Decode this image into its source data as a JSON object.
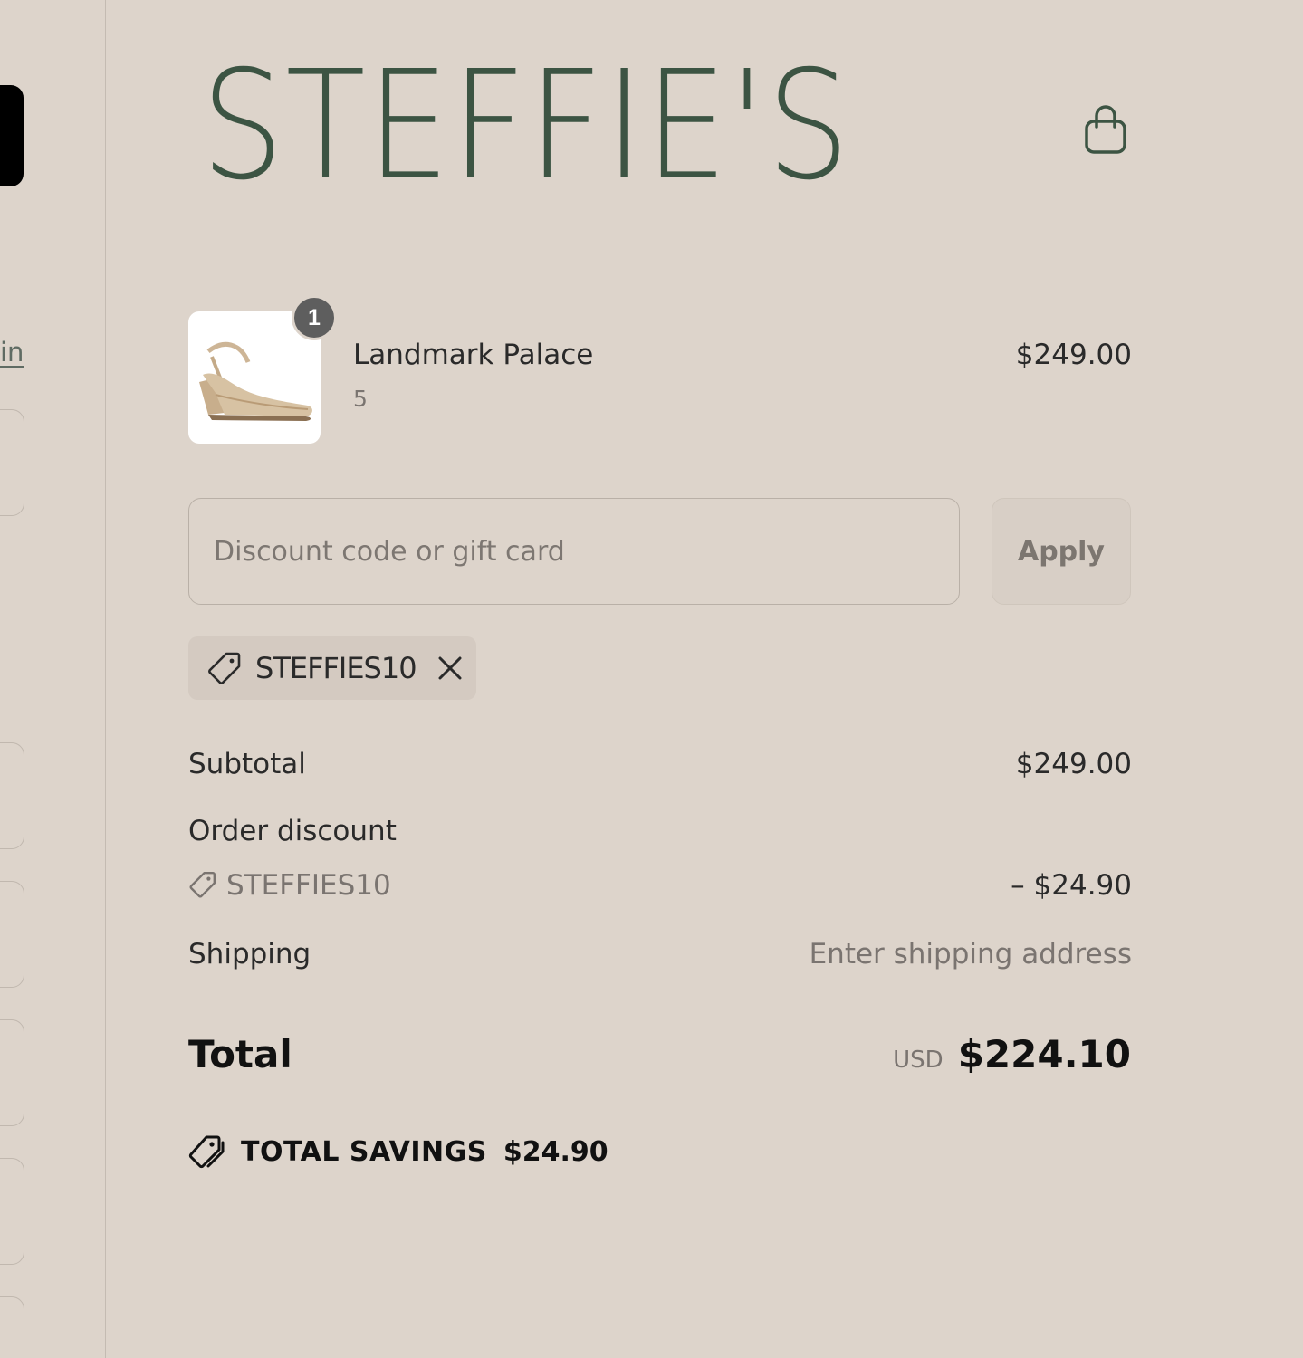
{
  "left_column": {
    "link_fragment": "in"
  },
  "brand": {
    "logo_text": "STEFFIE'S"
  },
  "cart_icon": "shopping-bag-icon",
  "line_item": {
    "quantity": "1",
    "name": "Landmark Palace",
    "variant": "5",
    "price": "$249.00",
    "image": "beige-wedge-sandal"
  },
  "discount": {
    "placeholder": "Discount code or gift card",
    "apply_label": "Apply",
    "applied_code": "STEFFIES10"
  },
  "summary": {
    "subtotal_label": "Subtotal",
    "subtotal_value": "$249.00",
    "order_discount_label": "Order discount",
    "discount_code": "STEFFIES10",
    "discount_value": "– $24.90",
    "shipping_label": "Shipping",
    "shipping_value": "Enter shipping address",
    "total_label": "Total",
    "currency": "USD",
    "total_value": "$224.10",
    "savings_label": "TOTAL SAVINGS",
    "savings_value": "$24.90"
  },
  "colors": {
    "background": "#ddd4cb",
    "brand_green": "#3c5443",
    "chip_background": "#d4cac1",
    "badge": "#5e5e5e"
  }
}
